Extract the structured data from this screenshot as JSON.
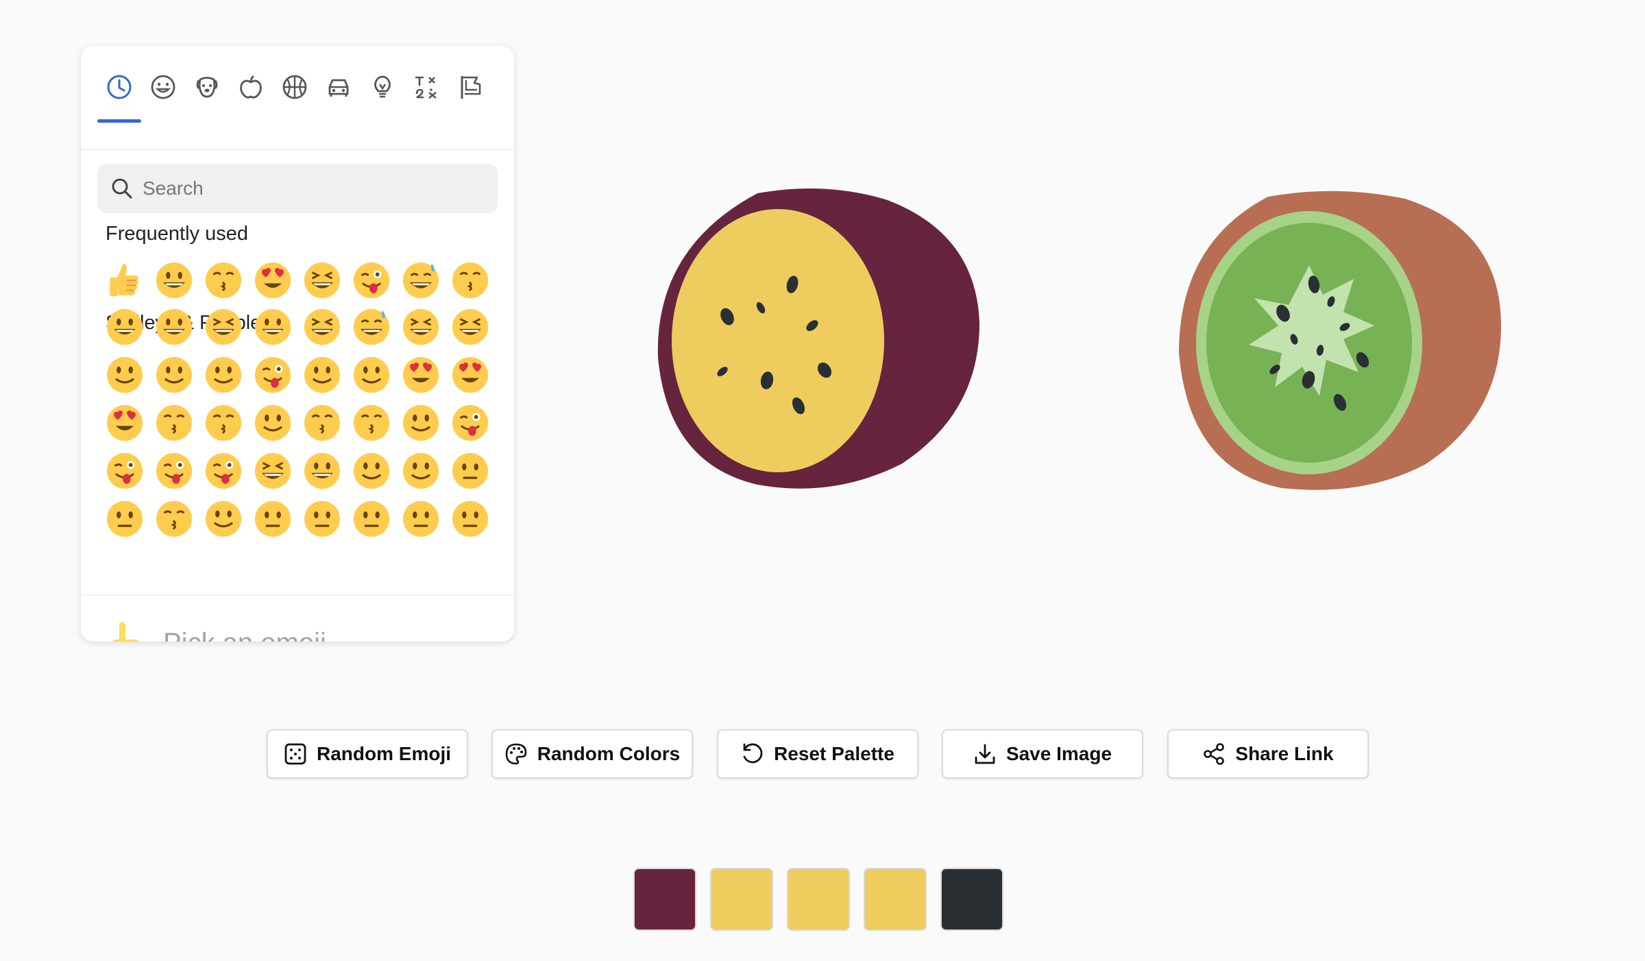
{
  "picker": {
    "categories": [
      {
        "name": "recent",
        "icon": "clock-icon",
        "active": true
      },
      {
        "name": "smileys",
        "icon": "smiley-icon"
      },
      {
        "name": "animals",
        "icon": "dog-icon"
      },
      {
        "name": "food",
        "icon": "apple-icon"
      },
      {
        "name": "activities",
        "icon": "basketball-icon"
      },
      {
        "name": "travel",
        "icon": "car-icon"
      },
      {
        "name": "objects",
        "icon": "lightbulb-icon"
      },
      {
        "name": "symbols",
        "icon": "symbols-icon"
      },
      {
        "name": "flags",
        "icon": "flag-icon"
      }
    ],
    "search": {
      "placeholder": "Search",
      "value": ""
    },
    "frequently_used_title": "Frequently used",
    "smileys_title": "Smileys & People",
    "frequently_used": [
      "👍",
      "😃",
      "😘",
      "😍",
      "😆",
      "😜",
      "😅",
      "😙"
    ],
    "smileys_rows": [
      [
        "😀",
        "😃",
        "😄",
        "😁",
        "😆",
        "😅",
        "🤣",
        "😂"
      ],
      [
        "🙂",
        "🙃",
        "🫠",
        "😉",
        "😊",
        "😇",
        "🥰",
        "😍"
      ],
      [
        "🤩",
        "😘",
        "😗",
        "☺️",
        "😚",
        "😙",
        "🥲",
        "😋"
      ],
      [
        "😛",
        "😜",
        "🤪",
        "😝",
        "🤑",
        "🤗",
        "🤭",
        "🫢"
      ],
      [
        "🫣",
        "🤫",
        "🤔",
        "🫡",
        "🤐",
        "🤨",
        "😐",
        "😑"
      ]
    ],
    "preview": {
      "emoji": "☝️",
      "text": "Pick an emoji…"
    }
  },
  "canvas": {
    "left_fruit": {
      "name": "passion fruit",
      "colors": {
        "skin": "#66243e",
        "flesh": "#eecd5e",
        "seeds": "#292f33"
      }
    },
    "right_fruit": {
      "name": "kiwi fruit",
      "colors": {
        "skin": "#b86e52",
        "rim": "#a6d388",
        "flesh": "#77b255",
        "core": "#c6e5b3",
        "seeds": "#292f33"
      }
    }
  },
  "toolbar": {
    "random_emoji": "Random Emoji",
    "random_colors": "Random Colors",
    "reset_palette": "Reset Palette",
    "save_image": "Save Image",
    "share_link": "Share Link"
  },
  "palette": [
    "#66243e",
    "#eecd5e",
    "#eecd5e",
    "#eecd5e",
    "#292f33"
  ]
}
